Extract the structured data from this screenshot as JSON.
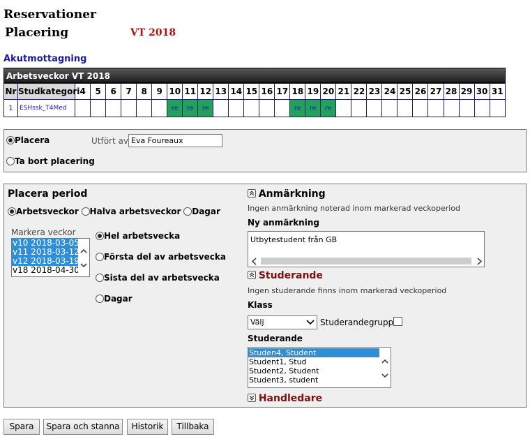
{
  "header": {
    "title": "Reservationer",
    "subtitle": "Placering",
    "term": "VT 2018",
    "unit_link": "Akutmottagning"
  },
  "weeks_table": {
    "title": "Arbetsveckor VT 2018",
    "col_nr": "Nr",
    "col_category": "Studkategori",
    "weeks": [
      "4",
      "5",
      "6",
      "7",
      "8",
      "9",
      "10",
      "11",
      "12",
      "13",
      "14",
      "15",
      "16",
      "17",
      "18",
      "19",
      "20",
      "21",
      "22",
      "23",
      "24",
      "25",
      "26",
      "27",
      "28",
      "29",
      "30",
      "31"
    ],
    "rows": [
      {
        "nr": "1",
        "category": "ESHssk_T4Med",
        "cells": [
          "",
          "",
          "",
          "",
          "",
          "",
          "re",
          "re",
          "re",
          "",
          "",
          "",
          "",
          "",
          "re",
          "re",
          "re",
          "",
          "",
          "",
          "",
          "",
          "",
          "",
          "",
          "",
          "",
          ""
        ]
      }
    ]
  },
  "action_panel": {
    "place_label": "Placera",
    "remove_label": "Ta bort placering",
    "performed_by_label": "Utfört av",
    "performed_by_value": "Eva Foureaux"
  },
  "period_panel": {
    "title": "Placera period",
    "mode_options": [
      "Arbetsveckor",
      "Halva arbetsveckor",
      "Dagar"
    ],
    "selected_mode": "Arbetsveckor",
    "weeks_list_label": "Markera veckor",
    "weeks_list": [
      {
        "label": "v10 2018-03-05",
        "selected": true
      },
      {
        "label": "v11 2018-03-12",
        "selected": true
      },
      {
        "label": "v12 2018-03-19",
        "selected": true
      },
      {
        "label": "v18 2018-04-30",
        "selected": false
      }
    ],
    "week_part_options": [
      "Hel arbetsvecka",
      "Första del av arbetsvecka",
      "Sista del av arbetsvecka",
      "Dagar"
    ],
    "selected_week_part": "Hel arbetsvecka"
  },
  "remark_section": {
    "title": "Anmärkning",
    "info": "Ingen anmärkning noterad inom markerad veckoperiod",
    "new_label": "Ny anmärkning",
    "new_value": "Utbytestudent från GB"
  },
  "students_section": {
    "title": "Studerande",
    "info": "Ingen studerande finns inom markerad veckoperiod",
    "class_label": "Klass",
    "class_value": "Välj",
    "group_label": "Studerandegrupp",
    "students_label": "Studerande",
    "students": [
      {
        "label": "Studen4, Student",
        "selected": true
      },
      {
        "label": "Student1, Stud",
        "selected": false
      },
      {
        "label": "Student2, Student",
        "selected": false
      },
      {
        "label": "Student3, student",
        "selected": false
      }
    ]
  },
  "supervisor_section": {
    "title": "Handledare"
  },
  "buttons": {
    "save": "Spara",
    "save_stay": "Spara och stanna",
    "history": "Historik",
    "back": "Tillbaka"
  },
  "colors": {
    "accent_red": "#b01010",
    "link_blue": "#1a1aa8",
    "reserved_green": "#21a25a",
    "selection_blue": "#2f8ed8"
  }
}
